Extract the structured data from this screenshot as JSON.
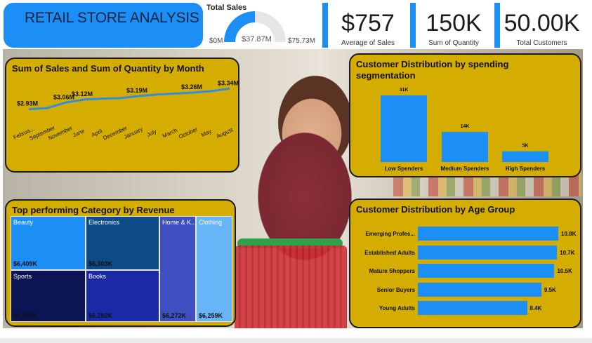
{
  "header": {
    "title": "RETAIL STORE ANALYSIS",
    "gauge": {
      "title": "Total Sales",
      "min": "$0M",
      "value": "$37.87M",
      "max": "$75.73M",
      "fraction": 0.5
    },
    "kpis": [
      {
        "value": "$757",
        "label": "Average of Sales"
      },
      {
        "value": "150K",
        "label": "Sum of Quantity"
      },
      {
        "value": "50.00K",
        "label": "Total Customers"
      }
    ]
  },
  "colors": {
    "accent": "#1b8ff5",
    "panel": "#d4ad00",
    "dark_navy": "#0a1a6b"
  },
  "line_panel": {
    "title": "Sum of Sales and Sum of Quantity by Month",
    "chart_data": {
      "type": "line",
      "title": "Sum of Sales and Sum of Quantity by Month",
      "categories": [
        "Februa...",
        "September",
        "November",
        "June",
        "April",
        "December",
        "January",
        "July",
        "March",
        "October",
        "May",
        "August"
      ],
      "series": [
        {
          "values": [
            2.93,
            2.95,
            3.06,
            3.12,
            3.14,
            3.15,
            3.19,
            3.22,
            3.24,
            3.26,
            3.29,
            3.34
          ]
        }
      ],
      "data_labels": [
        "$2.93M",
        "$3.06M",
        "$3.12M",
        "$3.19M",
        "$3.26M",
        "$3.34M"
      ],
      "labeled_indices": [
        0,
        2,
        3,
        6,
        9,
        11
      ],
      "ylim": [
        2.7,
        3.4
      ]
    }
  },
  "spend_panel": {
    "title_line1": "Customer Distribution by spending",
    "title_line2": "segmentation",
    "chart_data": {
      "type": "bar",
      "title": "Customer Distribution by spending segmentation",
      "categories": [
        "Low Spenders",
        "Medium Spenders",
        "High Spenders"
      ],
      "values": [
        31,
        14,
        5
      ],
      "value_labels": [
        "31K",
        "14K",
        "5K"
      ],
      "ylim": [
        0,
        31
      ]
    }
  },
  "treemap_panel": {
    "title": "Top performing Category by Revenue",
    "items": [
      {
        "name": "Beauty",
        "value": "$6,409K"
      },
      {
        "name": "Electronics",
        "value": "$6,303K"
      },
      {
        "name": "Sports",
        "value": "$6,343K"
      },
      {
        "name": "Books",
        "value": "$6,282K"
      },
      {
        "name": "Home & K...",
        "value": "$6,272K"
      },
      {
        "name": "Clothing",
        "value": "$6,259K"
      }
    ]
  },
  "age_panel": {
    "title": "Customer Distribution by Age Group",
    "chart_data": {
      "type": "bar",
      "title": "Customer Distribution by Age Group",
      "categories": [
        "Emerging Profes...",
        "Established Adults",
        "Mature Shoppers",
        "Senior Buyers",
        "Young Adults"
      ],
      "values": [
        10.8,
        10.7,
        10.5,
        9.5,
        8.4
      ],
      "value_labels": [
        "10.8K",
        "10.7K",
        "10.5K",
        "9.5K",
        "8.4K"
      ],
      "xlim": [
        0,
        10.8
      ]
    }
  }
}
